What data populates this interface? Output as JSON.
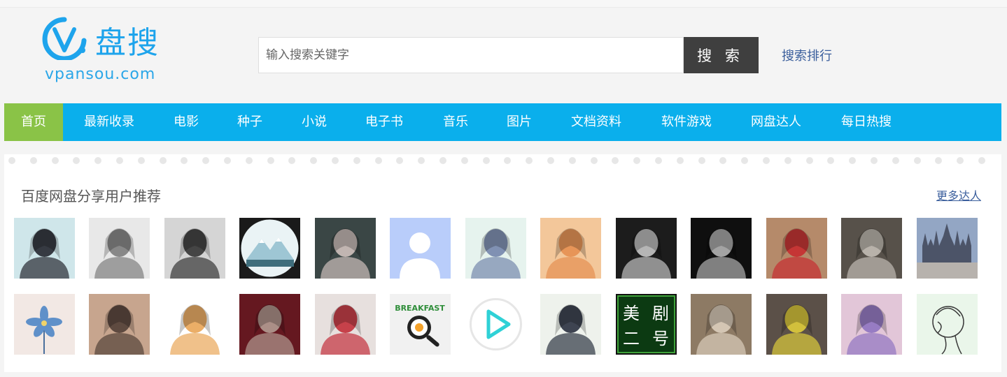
{
  "logo": {
    "name": "盘搜",
    "domain": "vpansou.com",
    "mark_letter": "V",
    "color": "#1ea4ec"
  },
  "search": {
    "placeholder": "输入搜索关键字",
    "value": "",
    "button_label": "搜 索",
    "rank_link": "搜索排行"
  },
  "nav": {
    "items": [
      {
        "label": "首页",
        "active": true
      },
      {
        "label": "最新收录"
      },
      {
        "label": "电影"
      },
      {
        "label": "种子"
      },
      {
        "label": "小说"
      },
      {
        "label": "电子书"
      },
      {
        "label": "音乐"
      },
      {
        "label": "图片"
      },
      {
        "label": "文档资料"
      },
      {
        "label": "软件游戏"
      },
      {
        "label": "网盘达人"
      },
      {
        "label": "每日热搜"
      }
    ],
    "bg_color": "#0aafec",
    "active_color": "#8ac347"
  },
  "panel": {
    "title": "百度网盘分享用户推荐",
    "more_link": "更多达人",
    "avatars_row1": [
      {
        "icon": "avatar-girl-portrait",
        "bg": "#cfe6ea",
        "fg": "#1b1b24"
      },
      {
        "icon": "avatar-sketch-girl",
        "bg": "#e8e8e8",
        "fg": "#777777"
      },
      {
        "icon": "avatar-bw-figure",
        "bg": "#d5d5d5",
        "fg": "#2b2b2b"
      },
      {
        "icon": "avatar-mountain-circle",
        "bg": "#1a1a1a",
        "fg": "#9ec6d4"
      },
      {
        "icon": "avatar-dark-anime",
        "bg": "#3a4645",
        "fg": "#d9c9c4"
      },
      {
        "icon": "avatar-default-user",
        "bg": "#b9cdfa",
        "fg": "#ffffff"
      },
      {
        "icon": "avatar-anime-girl",
        "bg": "#e6f3ee",
        "fg": "#6d7fa8"
      },
      {
        "icon": "avatar-orange-anime",
        "bg": "#f3c79a",
        "fg": "#e48c4c"
      },
      {
        "icon": "avatar-bw-hands",
        "bg": "#1c1c1c",
        "fg": "#d0d0d0"
      },
      {
        "icon": "avatar-bw-smoke",
        "bg": "#0f0f0f",
        "fg": "#bdbdbd"
      },
      {
        "icon": "avatar-photo-man",
        "bg": "#b58a6a",
        "fg": "#c8272c"
      },
      {
        "icon": "avatar-dark-warrior",
        "bg": "#57514a",
        "fg": "#c9c3bb"
      },
      {
        "icon": "avatar-cathedral",
        "bg": "#93a6c4",
        "fg": "#4c5468"
      }
    ],
    "avatars_row2": [
      {
        "icon": "avatar-blue-flower",
        "bg": "#f2e8e4",
        "fg": "#5f90c9"
      },
      {
        "icon": "avatar-mirror-girl",
        "bg": "#c7a58e",
        "fg": "#4b3a32"
      },
      {
        "icon": "avatar-cute-anime",
        "bg": "#ffffff",
        "fg": "#e8a04c"
      },
      {
        "icon": "avatar-hooded-old-man",
        "bg": "#651820",
        "fg": "#b7a49a"
      },
      {
        "icon": "avatar-anime-red-flower",
        "bg": "#e7e0de",
        "fg": "#c02430"
      },
      {
        "icon": "avatar-breakfast",
        "bg": "#f1f1f1",
        "fg": "#2f8e3a",
        "text": "BREAKFAST"
      },
      {
        "icon": "avatar-play-button",
        "bg": "#ffffff",
        "fg": "#2fd1d6"
      },
      {
        "icon": "avatar-anime-boy",
        "bg": "#eef2ec",
        "fg": "#1e2636"
      },
      {
        "icon": "avatar-text-logo",
        "bg": "#0c3a12",
        "fg": "#ffffff",
        "text": "美剧二号"
      },
      {
        "icon": "avatar-photo-group",
        "bg": "#8d7a64",
        "fg": "#e0d4c2"
      },
      {
        "icon": "avatar-girl-decorated",
        "bg": "#5b5048",
        "fg": "#e7d43b"
      },
      {
        "icon": "avatar-purple-anime",
        "bg": "#e2c6d8",
        "fg": "#8a6fc0"
      },
      {
        "icon": "avatar-line-art-girl",
        "bg": "#eaf6ea",
        "fg": "#3a3a3a"
      }
    ]
  }
}
